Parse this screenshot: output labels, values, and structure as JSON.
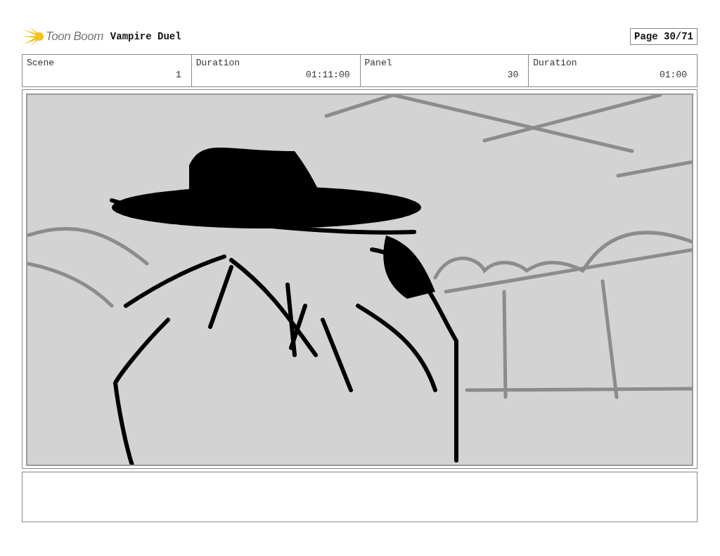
{
  "header": {
    "logo_text": "Toon Boom",
    "project_title": "Vampire Duel",
    "page": "Page 30/71"
  },
  "info": [
    {
      "label": "Scene",
      "value": "1"
    },
    {
      "label": "Duration",
      "value": "01:11:00"
    },
    {
      "label": "Panel",
      "value": "30"
    },
    {
      "label": "Duration",
      "value": "01:00"
    }
  ]
}
